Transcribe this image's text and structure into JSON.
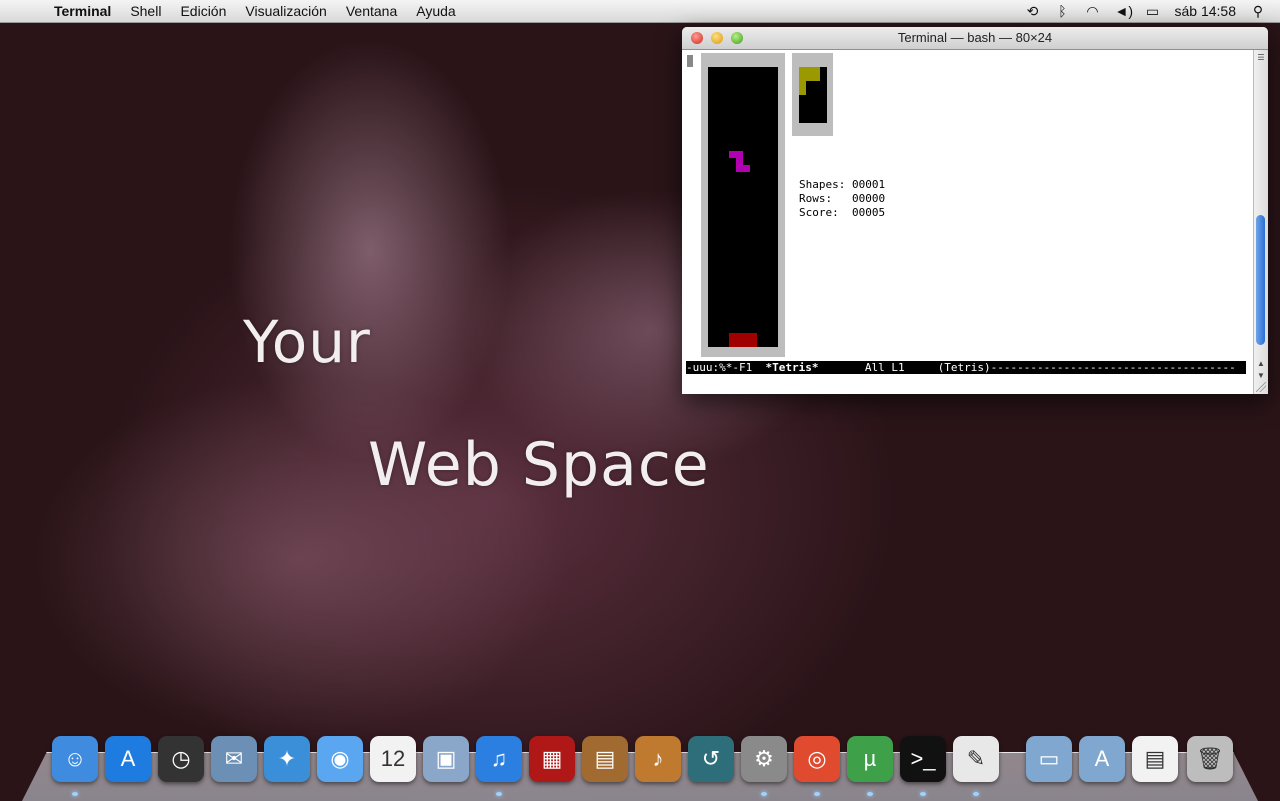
{
  "menubar": {
    "apple": "",
    "app": "Terminal",
    "menus": [
      "Shell",
      "Edición",
      "Visualización",
      "Ventana",
      "Ayuda"
    ],
    "clock": "sáb 14:58",
    "tray_icons": [
      "time-machine-icon",
      "bluetooth-icon",
      "wifi-icon",
      "volume-icon",
      "battery-icon",
      "spotlight-icon"
    ]
  },
  "wallpaper": {
    "line1": "Your",
    "line2": "Web Space"
  },
  "terminal": {
    "title": "Terminal — bash — 80×24",
    "stats": {
      "shapes": "Shapes: 00001",
      "rows": "Rows:   00000",
      "score": "Score:  00005"
    },
    "modeline": {
      "prefix": "-uuu:%*-F1  ",
      "buffer": "*Tetris*",
      "middle": "       All L1     ",
      "mode": "(Tetris)-------------------------------------"
    },
    "colors": {
      "falling_piece": "#b000b0",
      "next_piece": "#9a9a00",
      "stack": "#a00000"
    }
  },
  "dock": {
    "apps": [
      {
        "name": "finder",
        "glyph": "☺",
        "color": "#3f8be0"
      },
      {
        "name": "app-store",
        "glyph": "A",
        "color": "#1e7ce0"
      },
      {
        "name": "dashboard",
        "glyph": "◷",
        "color": "#333333"
      },
      {
        "name": "mail",
        "glyph": "✉",
        "color": "#6b8fb5"
      },
      {
        "name": "safari",
        "glyph": "✦",
        "color": "#3a8fd8"
      },
      {
        "name": "facetime-ichat",
        "glyph": "◉",
        "color": "#5aa6f0"
      },
      {
        "name": "calendar",
        "glyph": "12",
        "color": "#f2f2f2"
      },
      {
        "name": "preview",
        "glyph": "▣",
        "color": "#8aa6c8"
      },
      {
        "name": "itunes",
        "glyph": "♫",
        "color": "#2a7fe0"
      },
      {
        "name": "photo-booth",
        "glyph": "▦",
        "color": "#b01818"
      },
      {
        "name": "iphoto",
        "glyph": "▤",
        "color": "#a06a30"
      },
      {
        "name": "garageband",
        "glyph": "♪",
        "color": "#c07a30"
      },
      {
        "name": "time-machine",
        "glyph": "↺",
        "color": "#2e6e7a"
      },
      {
        "name": "system-preferences",
        "glyph": "⚙",
        "color": "#8a8a8a"
      },
      {
        "name": "chrome",
        "glyph": "◎",
        "color": "#e04a2f"
      },
      {
        "name": "utorrent",
        "glyph": "µ",
        "color": "#3fa04a"
      },
      {
        "name": "terminal",
        "glyph": ">_",
        "color": "#111111"
      },
      {
        "name": "textedit",
        "glyph": "✎",
        "color": "#e8e8e8"
      },
      {
        "name": "applications-folder",
        "glyph": "▭",
        "color": "#7fa7cf"
      },
      {
        "name": "documents-folder",
        "glyph": "A",
        "color": "#7fa7cf"
      },
      {
        "name": "chrome-download",
        "glyph": "▤",
        "color": "#f2f2f2"
      },
      {
        "name": "trash",
        "glyph": "🗑",
        "color": "#bdbdbd"
      }
    ]
  }
}
